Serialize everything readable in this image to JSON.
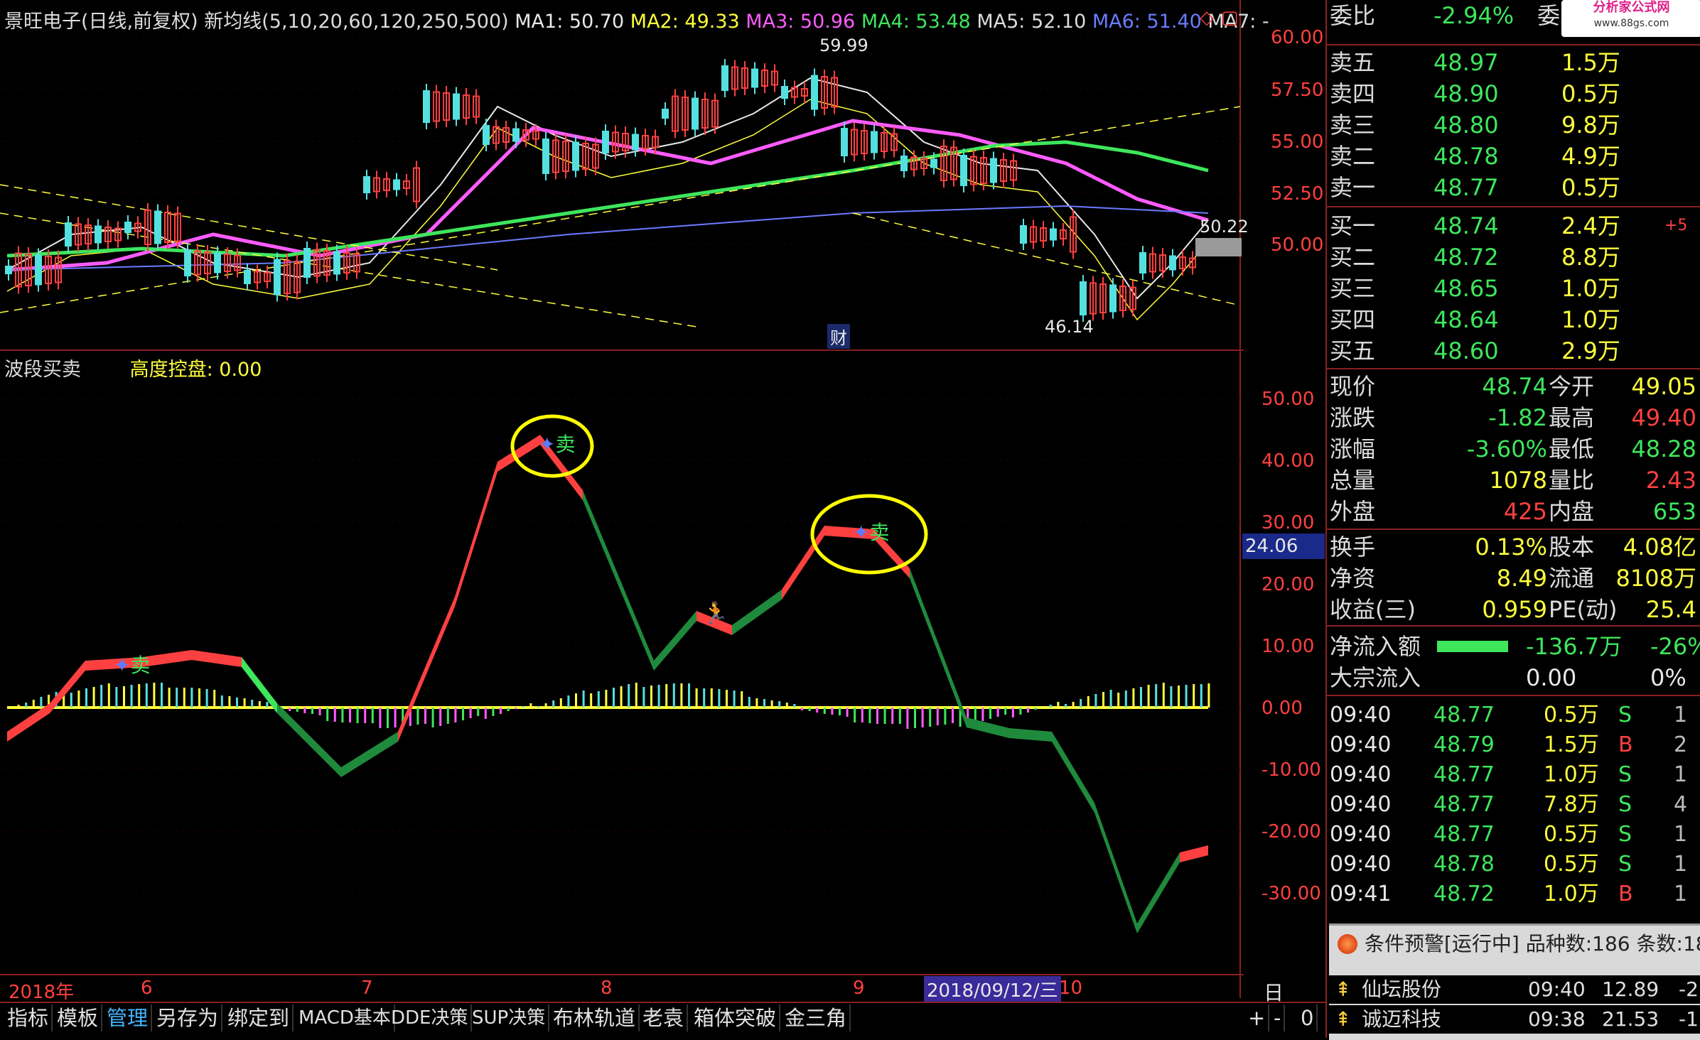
{
  "top_info": {
    "title": "景旺电子(日线,前复权)",
    "indicator": "新均线(5,10,20,60,120,250,500)",
    "ma1": "MA1: 50.70",
    "ma2": "MA2: 49.33",
    "ma3": "MA3: 50.96",
    "ma4": "MA4: 53.48",
    "ma5": "MA5: 52.10",
    "ma6": "MA6: 51.40",
    "ma7": "MA7: -",
    "ma_colors": {
      "ma1": "#e8e8e8",
      "ma2": "#ffff3c",
      "ma3": "#ff5cff",
      "ma4": "#3ee65c",
      "ma5": "#dcdcdc",
      "ma6": "#6b7bff",
      "ma7": "#dcdcdc"
    }
  },
  "price_axis": {
    "ticks": [
      "60.00",
      "57.50",
      "55.00",
      "52.50",
      "50.00"
    ],
    "high_label": "59.99",
    "low_label": "46.14",
    "current_label": "50.22",
    "cai_marker": "财"
  },
  "lower_panel": {
    "name": "波段买卖",
    "subtitle": "高度控盘: 0.00",
    "axis_ticks": [
      "50.00",
      "40.00",
      "30.00",
      "20.00",
      "10.00",
      "0.00",
      "-10.00",
      "-20.00",
      "-30.00"
    ],
    "current_value": "24.06",
    "sell_label": "卖",
    "sell_markers_count": 3
  },
  "date_axis": {
    "labels": [
      "2018年",
      "6",
      "7",
      "8",
      "9",
      "2018/09/12/三",
      "10"
    ],
    "period": "日线"
  },
  "toolbar": {
    "buttons": [
      "指标",
      "模板",
      "管理",
      "另存为",
      "绑定到",
      "MACD基本",
      "DDE决策",
      "SUP决策",
      "布林轨道",
      "老袁",
      "箱体突破",
      "金三角"
    ],
    "active_index": 2,
    "right_controls": [
      "+",
      "-",
      "0"
    ]
  },
  "quote_panel": {
    "weibi": {
      "label": "委比",
      "value": "-2.94%",
      "label2": "委差"
    },
    "asks": [
      {
        "label": "卖五",
        "price": "48.97",
        "vol": "1.5万"
      },
      {
        "label": "卖四",
        "price": "48.90",
        "vol": "0.5万"
      },
      {
        "label": "卖三",
        "price": "48.80",
        "vol": "9.8万"
      },
      {
        "label": "卖二",
        "price": "48.78",
        "vol": "4.9万"
      },
      {
        "label": "卖一",
        "price": "48.77",
        "vol": "0.5万"
      }
    ],
    "bids": [
      {
        "label": "买一",
        "price": "48.74",
        "vol": "2.4万",
        "extra": "+5"
      },
      {
        "label": "买二",
        "price": "48.72",
        "vol": "8.8万",
        "extra": ""
      },
      {
        "label": "买三",
        "price": "48.65",
        "vol": "1.0万",
        "extra": ""
      },
      {
        "label": "买四",
        "price": "48.64",
        "vol": "1.0万",
        "extra": ""
      },
      {
        "label": "买五",
        "price": "48.60",
        "vol": "2.9万",
        "extra": ""
      }
    ],
    "stats": [
      {
        "l1": "现价",
        "v1": "48.74",
        "l2": "今开",
        "v2": "49.05"
      },
      {
        "l1": "涨跌",
        "v1": "-1.82",
        "l2": "最高",
        "v2": "49.40"
      },
      {
        "l1": "涨幅",
        "v1": "-3.60%",
        "l2": "最低",
        "v2": "48.28"
      },
      {
        "l1": "总量",
        "v1": "1078",
        "l2": "量比",
        "v2": "2.43"
      },
      {
        "l1": "外盘",
        "v1": "425",
        "l2": "内盘",
        "v2": "653"
      }
    ],
    "stats2": [
      {
        "l1": "换手",
        "v1": "0.13%",
        "l2": "股本",
        "v2": "4.08亿"
      },
      {
        "l1": "净资",
        "v1": "8.49",
        "l2": "流通",
        "v2": "8108万"
      },
      {
        "l1": "收益(三)",
        "v1": "0.959",
        "l2": "PE(动)",
        "v2": "25.4"
      }
    ],
    "flow": [
      {
        "label": "净流入额",
        "value": "-136.7万",
        "pct": "-26%"
      },
      {
        "label": "大宗流入",
        "value": "0.00",
        "pct": "0%"
      }
    ],
    "ticks": [
      {
        "time": "09:40",
        "price": "48.77",
        "vol": "0.5万",
        "side": "S",
        "n": "1"
      },
      {
        "time": "09:40",
        "price": "48.79",
        "vol": "1.5万",
        "side": "B",
        "n": "2"
      },
      {
        "time": "09:40",
        "price": "48.77",
        "vol": "1.0万",
        "side": "S",
        "n": "1"
      },
      {
        "time": "09:40",
        "price": "48.77",
        "vol": "7.8万",
        "side": "S",
        "n": "4"
      },
      {
        "time": "09:40",
        "price": "48.77",
        "vol": "0.5万",
        "side": "S",
        "n": "1"
      },
      {
        "time": "09:40",
        "price": "48.78",
        "vol": "0.5万",
        "side": "S",
        "n": "1"
      },
      {
        "time": "09:41",
        "price": "48.72",
        "vol": "1.0万",
        "side": "B",
        "n": "1"
      }
    ]
  },
  "alert": {
    "title": "条件预警[运行中] 品种数:186 条数:18",
    "rows": [
      {
        "name": "仙坛股份",
        "time": "09:40",
        "price": "12.89",
        "chg": "-2"
      },
      {
        "name": "诚迈科技",
        "time": "09:38",
        "price": "21.53",
        "chg": "-1"
      }
    ]
  },
  "watermark": {
    "brand": "分析家公式网",
    "url": "www.88gs.com"
  }
}
